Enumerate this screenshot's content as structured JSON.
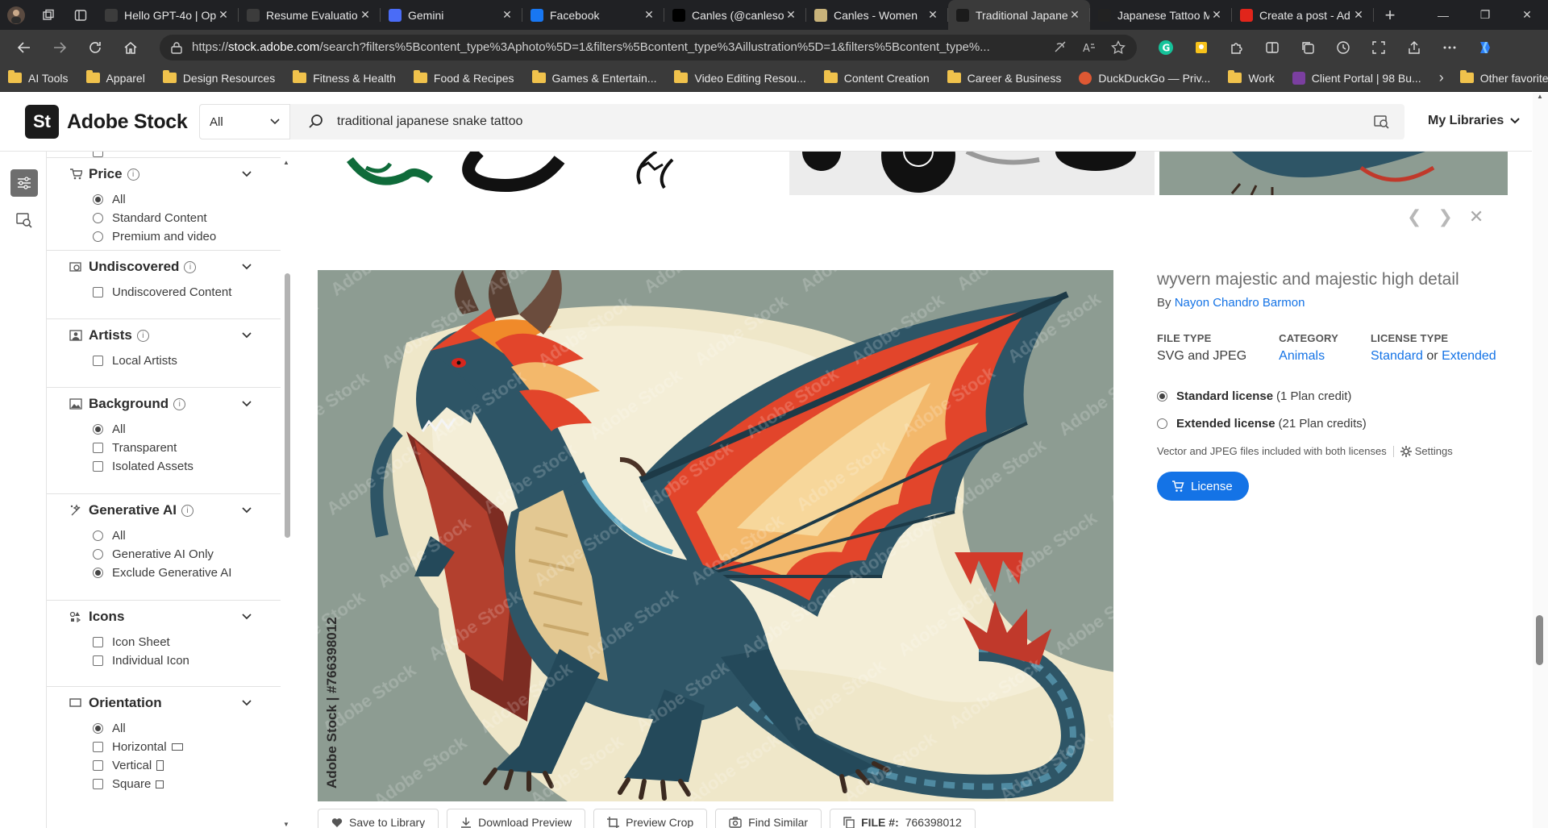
{
  "browser": {
    "tabs": [
      {
        "title": "Hello GPT-4o | Op",
        "favicon": "openai-icon",
        "color": "#3c3c3c"
      },
      {
        "title": "Resume Evaluatio",
        "favicon": "openai-icon",
        "color": "#3c3c3c"
      },
      {
        "title": "Gemini",
        "favicon": "gemini-icon",
        "color": "#4a6cf7"
      },
      {
        "title": "Facebook",
        "favicon": "facebook-icon",
        "color": "#1877f2"
      },
      {
        "title": "Canles (@canleso",
        "favicon": "x-icon",
        "color": "#000000"
      },
      {
        "title": "Canles - Women",
        "favicon": "canles-icon",
        "color": "#c9b37a"
      },
      {
        "title": "Traditional Japane",
        "favicon": "adobe-stock-icon",
        "color": "#1b1b1b",
        "active": true
      },
      {
        "title": "Japanese Tattoo M",
        "favicon": "io-icon",
        "color": "#222222"
      },
      {
        "title": "Create a post - Ad",
        "favicon": "adobe-icon",
        "color": "#e1251b"
      }
    ],
    "url": {
      "prefix": "https://",
      "host": "stock.adobe.com",
      "rest": "/search?filters%5Bcontent_type%3Aphoto%5D=1&filters%5Bcontent_type%3Aillustration%5D=1&filters%5Bcontent_type%..."
    },
    "bookmarks": [
      {
        "label": "AI Tools"
      },
      {
        "label": "Apparel"
      },
      {
        "label": "Design Resources"
      },
      {
        "label": "Fitness & Health"
      },
      {
        "label": "Food & Recipes"
      },
      {
        "label": "Games & Entertain..."
      },
      {
        "label": "Video Editing Resou..."
      },
      {
        "label": "Content Creation"
      },
      {
        "label": "Career & Business"
      },
      {
        "label": "DuckDuckGo — Priv..."
      },
      {
        "label": "Work"
      },
      {
        "label": "Client Portal | 98 Bu..."
      }
    ],
    "other_favorites": "Other favorites"
  },
  "header": {
    "logo_mark": "St",
    "logo_text": "Adobe Stock",
    "search_scope": "All",
    "search_query": "traditional japanese snake tattoo",
    "my_libraries": "My Libraries"
  },
  "filters": {
    "price": {
      "title": "Price",
      "options": [
        "All",
        "Standard Content",
        "Premium and video"
      ],
      "selected": 0
    },
    "undiscovered": {
      "title": "Undiscovered",
      "options": [
        "Undiscovered Content"
      ]
    },
    "artists": {
      "title": "Artists",
      "options": [
        "Local Artists"
      ]
    },
    "background": {
      "title": "Background",
      "options": [
        "All",
        "Transparent",
        "Isolated Assets"
      ],
      "selected": 0
    },
    "generative_ai": {
      "title": "Generative AI",
      "options": [
        "All",
        "Generative AI Only",
        "Exclude Generative AI"
      ],
      "selected": 2
    },
    "icons": {
      "title": "Icons",
      "options": [
        "Icon Sheet",
        "Individual Icon"
      ]
    },
    "orientation": {
      "title": "Orientation",
      "options": [
        "All",
        "Horizontal",
        "Vertical",
        "Square"
      ],
      "selected": 0
    }
  },
  "preview": {
    "watermark": "Adobe Stock | #766398012",
    "title": "wyvern majestic and majestic high detail",
    "by_label": "By",
    "author": "Nayon Chandro Barmon",
    "meta": {
      "file_type_label": "FILE TYPE",
      "file_type": "SVG and JPEG",
      "category_label": "CATEGORY",
      "category": "Animals",
      "license_type_label": "LICENSE TYPE",
      "license_standard": "Standard",
      "license_or": "or",
      "license_extended": "Extended"
    },
    "licenses": [
      {
        "name": "Standard license",
        "credits": "(1 Plan credit)",
        "selected": true
      },
      {
        "name": "Extended license",
        "credits": "(21 Plan credits)",
        "selected": false
      }
    ],
    "note": "Vector and JPEG files included with both licenses",
    "settings": "Settings",
    "license_button": "License",
    "actions": {
      "save": "Save to Library",
      "download": "Download Preview",
      "crop": "Preview Crop",
      "similar": "Find Similar",
      "file_label": "FILE #:",
      "file_number": "766398012"
    }
  },
  "colors": {
    "accent": "#1473e6",
    "dragon_body": "#2e5566",
    "wing": "#e2452b",
    "wing_light": "#f3b86b",
    "background_blob": "#efe7c9",
    "image_bg": "#8d9c92"
  }
}
